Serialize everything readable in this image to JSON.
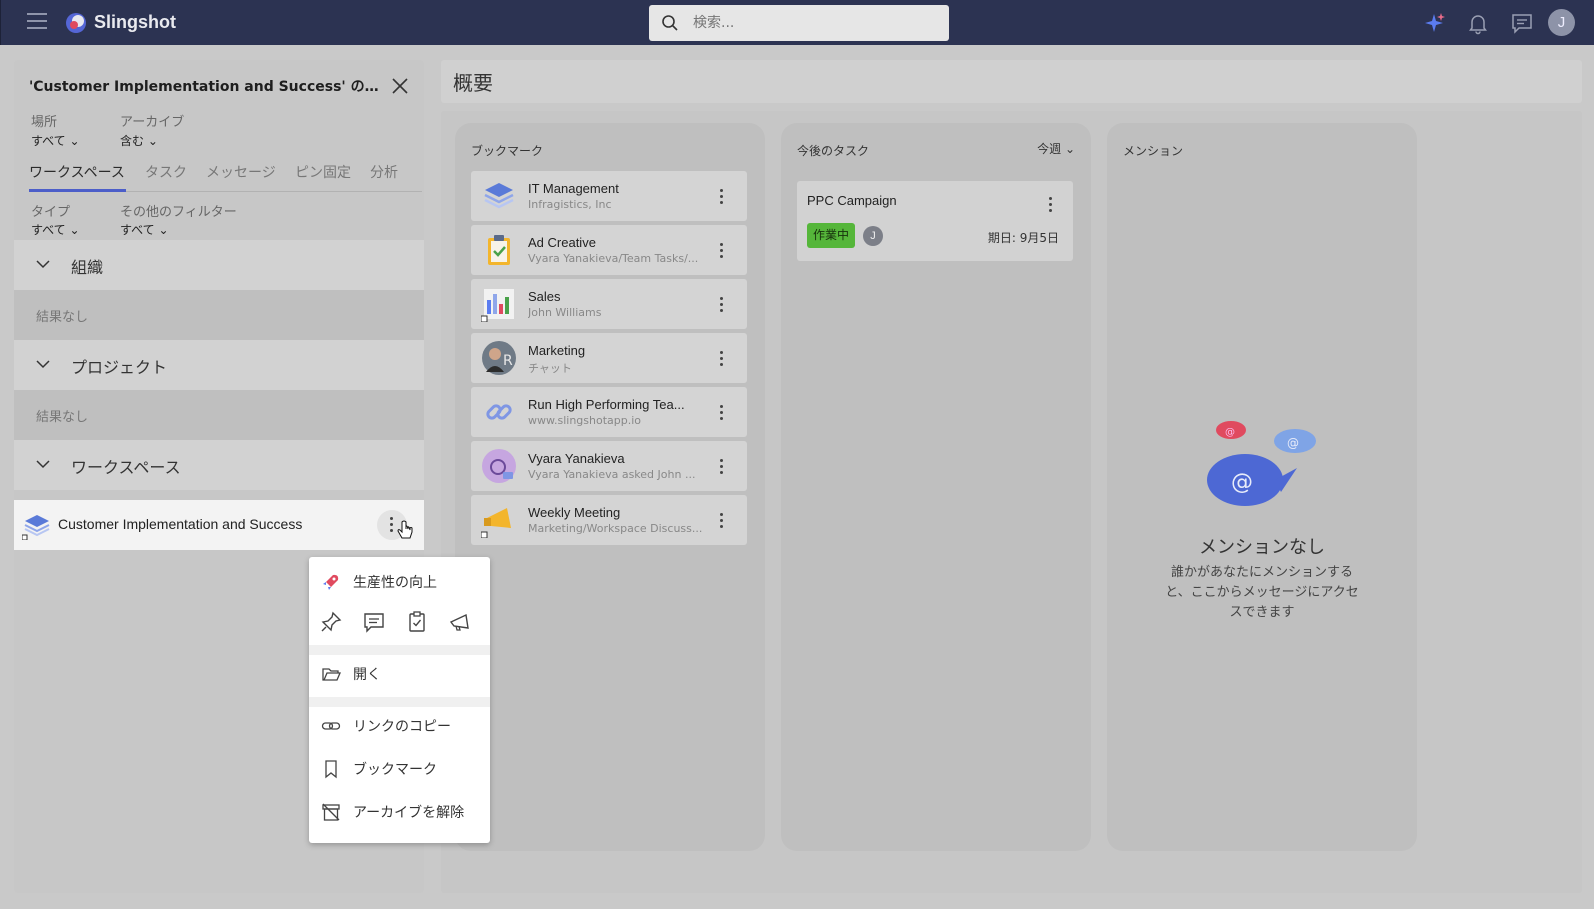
{
  "app": {
    "brand": "Slingshot",
    "search_placeholder": "検索...",
    "user_initial": "J",
    "accent": "#4c5ec9"
  },
  "left_panel": {
    "title": "'Customer Implementation and Success' の検索結果",
    "filters": {
      "location_label": "場所",
      "location_value": "すべて",
      "archive_label": "アーカイブ",
      "archive_value": "含む",
      "type_label": "タイプ",
      "type_value": "すべて",
      "other_label": "その他のフィルター",
      "other_value": "すべて"
    },
    "tabs": [
      "ワークスペース",
      "タスク",
      "メッセージ",
      "ピン固定",
      "分析"
    ],
    "sections": {
      "org_label": "組織",
      "org_empty": "結果なし",
      "project_label": "プロジェクト",
      "project_empty": "結果なし",
      "workspace_label": "ワークスペース"
    },
    "result_item": "Customer Implementation and Success"
  },
  "context_menu": {
    "header_item": "生産性の向上",
    "quick_actions": [
      "pin-icon",
      "message-icon",
      "task-icon",
      "announcement-icon"
    ],
    "open": "開く",
    "copy_link": "リンクのコピー",
    "bookmark": "ブックマーク",
    "unarchive": "アーカイブを解除"
  },
  "overview": {
    "title": "概要",
    "bookmarks": {
      "header": "ブックマーク",
      "items": [
        {
          "name": "IT Management",
          "sub": "Infragistics, Inc",
          "icon": "workspace-stack-icon"
        },
        {
          "name": "Ad Creative",
          "sub": "Vyara Yanakieva/Team Tasks/...",
          "icon": "clipboard-check-icon"
        },
        {
          "name": "Sales",
          "sub": "John Williams",
          "icon": "dashboard-icon"
        },
        {
          "name": "Marketing",
          "sub": "チャット",
          "icon": "avatar-icon"
        },
        {
          "name": "Run High Performing Tea...",
          "sub": "www.slingshotapp.io",
          "icon": "link-icon"
        },
        {
          "name": "Vyara Yanakieva",
          "sub": "Vyara Yanakieva asked John ...",
          "icon": "user-message-icon"
        },
        {
          "name": "Weekly Meeting",
          "sub": "Marketing/Workspace Discuss...",
          "icon": "megaphone-icon"
        }
      ]
    },
    "tasks": {
      "header": "今後のタスク",
      "period": "今週",
      "item": {
        "name": "PPC Campaign",
        "status": "作業中",
        "assignee": "J",
        "due": "期日: 9月5日"
      }
    },
    "mentions": {
      "header": "メンション",
      "empty_title": "メンションなし",
      "empty_text": "誰かがあなたにメンションすると、ここからメッセージにアクセスできます"
    }
  }
}
